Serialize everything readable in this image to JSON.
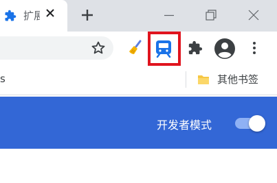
{
  "tab": {
    "title": "扩展程序",
    "icon": "puzzle-icon",
    "close_icon": "close-icon"
  },
  "titlebar": {
    "new_tab_icon": "plus-icon",
    "minimize_icon": "minimize-icon",
    "restore_icon": "restore-icon",
    "close_icon": "close-icon"
  },
  "toolbar": {
    "bookmark_star_icon": "star-icon",
    "extensions": [
      {
        "icon": "broom-icon"
      },
      {
        "icon": "train-icon",
        "highlighted": true
      }
    ],
    "extensions_menu_icon": "puzzle-icon",
    "profile_icon": "profile-icon",
    "menu_icon": "menu-dots-icon"
  },
  "bookmarks_bar": {
    "left_partial": "s",
    "other_bookmarks": "其他书签",
    "folder_icon": "folder-icon"
  },
  "page_header": {
    "developer_mode_label": "开发者模式",
    "developer_mode_on": true
  },
  "colors": {
    "header_blue": "#3367d6",
    "highlight_red": "#e0141e",
    "tab_icon_blue": "#1a73e8"
  }
}
